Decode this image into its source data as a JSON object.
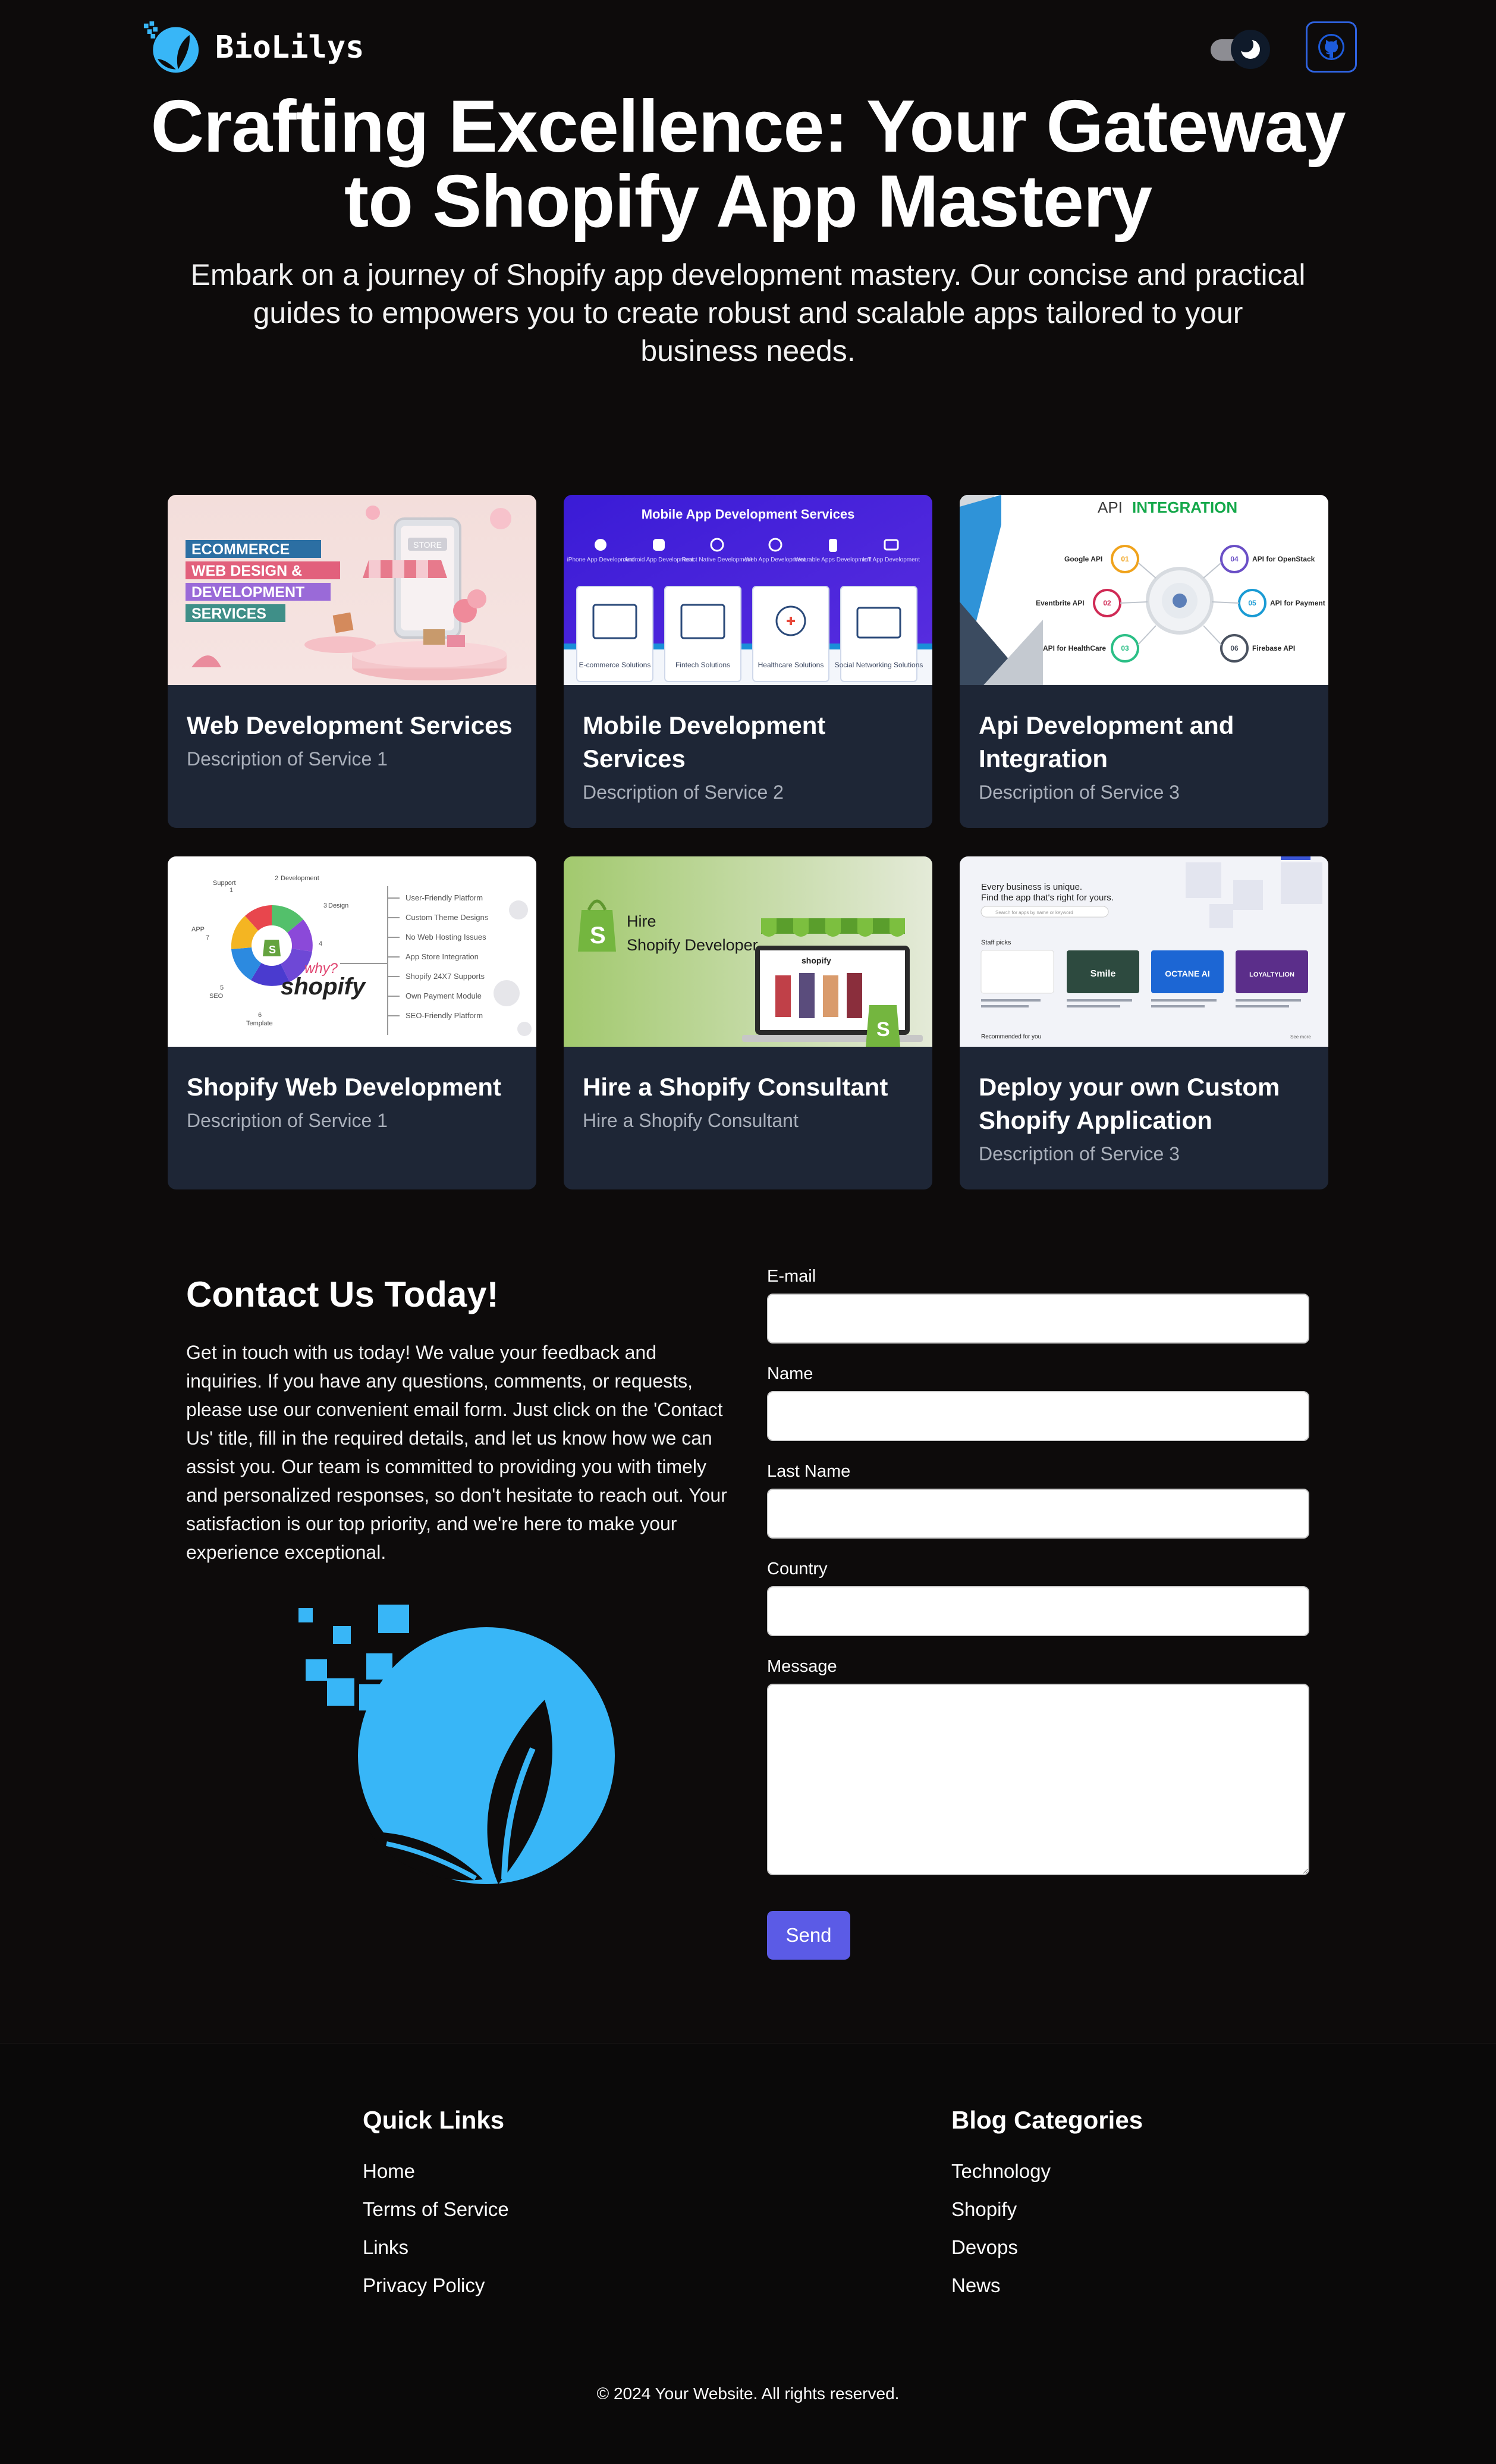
{
  "header": {
    "brand_name": "BioLilys",
    "theme_toggle_mode": "dark",
    "github_icon": "github-icon"
  },
  "hero": {
    "title": "Crafting Excellence: Your Gateway to Shopify App Mastery",
    "subtitle": "Embark on a journey of Shopify app development mastery. Our concise and practical guides to empowers you to create robust and scalable apps tailored to your business needs."
  },
  "services": [
    {
      "title": "Web Development Services",
      "description": "Description of Service 1",
      "image_text": [
        "ECOMMERCE",
        "WEB DESIGN &",
        "DEVELOPMENT",
        "SERVICES"
      ],
      "store_sign": "STORE"
    },
    {
      "title": "Mobile Development Services",
      "description": "Description of Service 2",
      "image_heading": "Mobile App Development Services",
      "platforms": [
        "iPhone App Development",
        "Android App Development",
        "React Native Development",
        "Web App Development",
        "Wearable Apps Development",
        "IoT App Development"
      ],
      "solutions": [
        "E-commerce Solutions",
        "Fintech Solutions",
        "Healthcare Solutions",
        "Social Networking Solutions"
      ]
    },
    {
      "title": "Api Development and Integration",
      "description": "Description of Service 3",
      "image_heading_1": "API",
      "image_heading_2": "INTEGRATION",
      "nodes": [
        {
          "num": "01",
          "label": "Google API"
        },
        {
          "num": "02",
          "label": "Eventbrite API"
        },
        {
          "num": "03",
          "label": "API for HealthCare"
        },
        {
          "num": "04",
          "label": "API for OpenStack"
        },
        {
          "num": "05",
          "label": "API for Payment"
        },
        {
          "num": "06",
          "label": "Firebase API"
        }
      ]
    },
    {
      "title": "Shopify Web Development",
      "description": "Description of Service 1",
      "wheel_labels": [
        "Support",
        "Development",
        "Design",
        "APP",
        "SEO",
        "Template"
      ],
      "wheel_numbers": [
        "1",
        "2",
        "3",
        "4",
        "5",
        "6",
        "7"
      ],
      "why_text": "why?",
      "brand_text": "shopify",
      "features": [
        "User-Friendly Platform",
        "Custom Theme Designs",
        "No Web Hosting Issues",
        "App Store Integration",
        "Shopify 24X7 Supports",
        "Own Payment Module",
        "SEO-Friendly Platform"
      ]
    },
    {
      "title": "Hire a Shopify Consultant",
      "description": "Hire a Shopify Consultant",
      "image_line_1": "Hire",
      "image_line_2": "Shopify Developer",
      "screen_brand": "shopify"
    },
    {
      "title": "Deploy your own Custom Shopify Application",
      "description": "Description of Service 3",
      "line_1": "Every business is unique.",
      "line_2": "Find the app that's right for yours.",
      "search_placeholder": "Search for apps by name or keyword",
      "staff_picks": "Staff picks",
      "recommended": "Recommended for you",
      "see_more": "See more",
      "app_tiles": [
        "Smile",
        "OCTANE AI",
        "LOYALTYLION"
      ]
    }
  ],
  "contact": {
    "title": "Contact Us Today!",
    "text": "Get in touch with us today! We value your feedback and inquiries. If you have any questions, comments, or requests, please use our convenient email form. Just click on the 'Contact Us' title, fill in the required details, and let us know how we can assist you. Our team is committed to providing you with timely and personalized responses, so don't hesitate to reach out. Your satisfaction is our top priority, and we're here to make your experience exceptional.",
    "fields": {
      "email_label": "E-mail",
      "email_value": "",
      "name_label": "Name",
      "name_value": "",
      "lastname_label": "Last Name",
      "lastname_value": "",
      "country_label": "Country",
      "country_value": "",
      "message_label": "Message",
      "message_value": ""
    },
    "send_label": "Send"
  },
  "footer": {
    "quick_links_title": "Quick Links",
    "quick_links": [
      "Home",
      "Terms of Service",
      "Links",
      "Privacy Policy"
    ],
    "blog_title": "Blog Categories",
    "blog_categories": [
      "Technology",
      "Shopify",
      "Devops",
      "News"
    ],
    "copyright": "© 2024 Your Website. All rights reserved."
  },
  "colors": {
    "background": "#0d0b0b",
    "card": "#1e2636",
    "accent_blue": "#38b6f7",
    "send_button": "#5b5be6",
    "github_border": "#2f63e0"
  }
}
